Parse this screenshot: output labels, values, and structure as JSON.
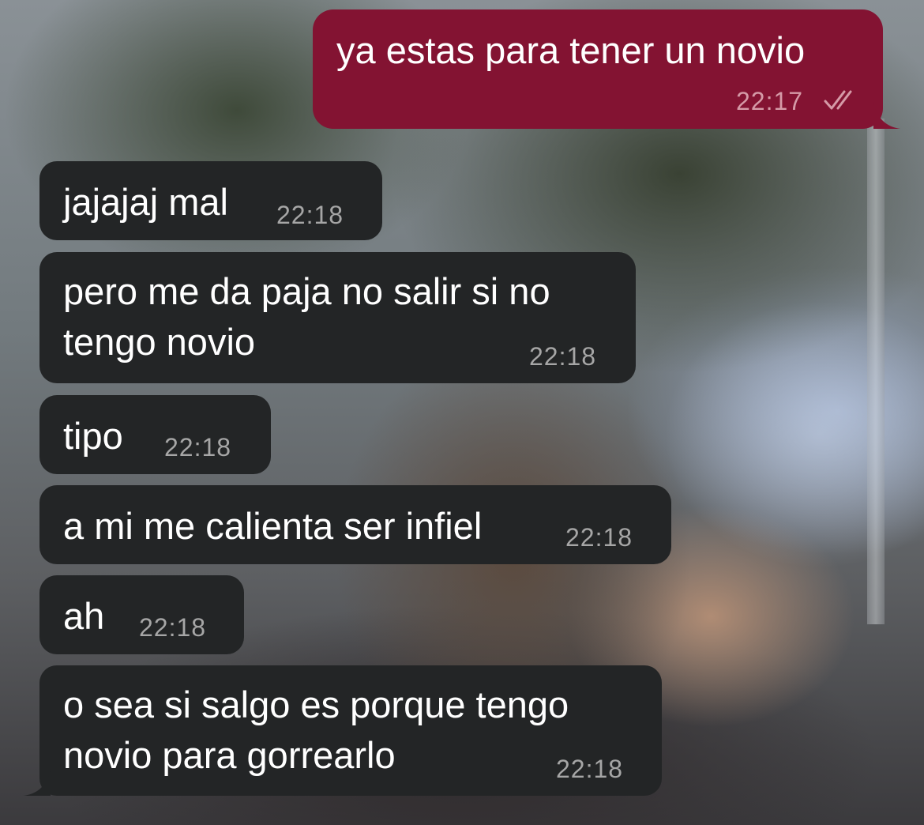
{
  "messages": [
    {
      "direction": "outgoing",
      "text": "ya estas para tener un novio",
      "time": "22:17",
      "status_icon": "double-check-icon"
    },
    {
      "direction": "incoming",
      "text": "jajajaj mal",
      "time": "22:18"
    },
    {
      "direction": "incoming",
      "lines": [
        "pero me da paja no salir si no",
        "tengo novio"
      ],
      "time": "22:18"
    },
    {
      "direction": "incoming",
      "text": "tipo",
      "time": "22:18"
    },
    {
      "direction": "incoming",
      "text": "a mi me calienta ser infiel",
      "time": "22:18"
    },
    {
      "direction": "incoming",
      "text": "ah",
      "time": "22:18"
    },
    {
      "direction": "incoming",
      "lines": [
        "o sea si salgo es porque tengo",
        "novio para gorrearlo"
      ],
      "time": "22:18"
    }
  ],
  "colors": {
    "outgoing_bubble": "#831332",
    "incoming_bubble": "#232526",
    "message_text": "#ffffff",
    "incoming_time": "#a6a6a6",
    "outgoing_time": "#d59aa7"
  }
}
